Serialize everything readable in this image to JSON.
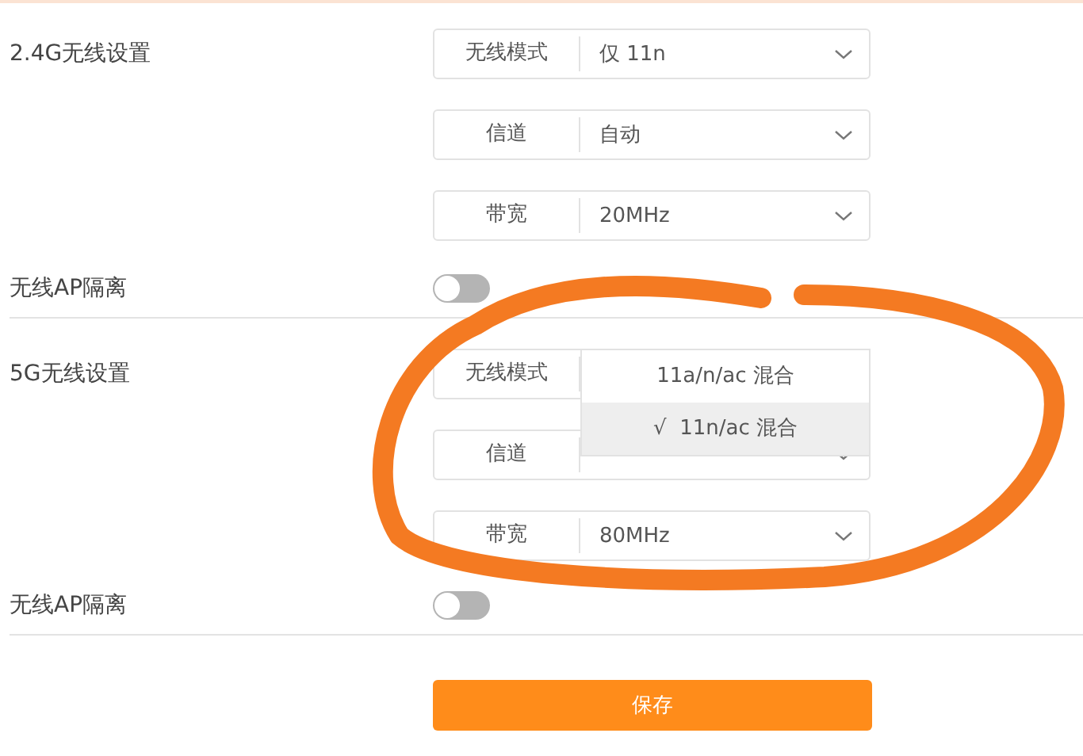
{
  "sections": [
    {
      "title": "2.4G无线设置",
      "fields": [
        {
          "label": "无线模式",
          "value": "仅 11n"
        },
        {
          "label": "信道",
          "value": "自动"
        },
        {
          "label": "带宽",
          "value": "20MHz"
        }
      ],
      "isolation": {
        "label": "无线AP隔离",
        "on": false
      }
    },
    {
      "title": "5G无线设置",
      "fields": [
        {
          "label": "无线模式",
          "open": true,
          "options": [
            {
              "label": "11a/n/ac 混合",
              "selected": false
            },
            {
              "label": "11n/ac 混合",
              "selected": true,
              "check": "√"
            }
          ]
        },
        {
          "label": "信道"
        },
        {
          "label": "带宽",
          "value": "80MHz"
        }
      ],
      "isolation": {
        "label": "无线AP隔离",
        "on": false
      }
    }
  ],
  "save_button": "保存",
  "annotation": {
    "kind": "loop"
  }
}
